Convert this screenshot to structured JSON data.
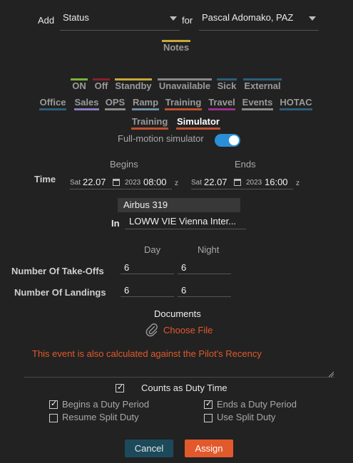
{
  "header": {
    "add_label": "Add",
    "type_value": "Status",
    "for_label": "for",
    "person_value": "Pascal Adomako, PAZ"
  },
  "notes_tab": {
    "label": "Notes",
    "color": "#c8a83a"
  },
  "status_row": [
    {
      "label": "ON",
      "color": "#7bb23a"
    },
    {
      "label": "Off",
      "color": "#8a1f2a"
    },
    {
      "label": "Standby",
      "color": "#c8a83a"
    },
    {
      "label": "Unavailable",
      "color": "#8a8a8a"
    },
    {
      "label": "Sick",
      "color": "#2b5f7a"
    },
    {
      "label": "External",
      "color": "#2b5f7a"
    }
  ],
  "category_row": [
    {
      "label": "Office",
      "color": "#2b5f7a"
    },
    {
      "label": "Sales",
      "color": "#8a7bbf"
    },
    {
      "label": "OPS",
      "color": "#8a8a8a"
    },
    {
      "label": "Ramp",
      "color": "#6f8fa6"
    },
    {
      "label": "Training",
      "color": "#c0502e"
    },
    {
      "label": "Travel",
      "color": "#9b2f8a"
    },
    {
      "label": "Events",
      "color": "#8a8a8a"
    },
    {
      "label": "HOTAC",
      "color": "#2b5f7a"
    }
  ],
  "subtype_row": [
    {
      "label": "Training",
      "color": "#c0502e"
    },
    {
      "label": "Simulator",
      "color": "#c0502e"
    }
  ],
  "full_motion": {
    "label": "Full-motion simulator",
    "on": true
  },
  "time": {
    "label": "Time",
    "begins_label": "Begins",
    "ends_label": "Ends",
    "begin": {
      "day": "Sat",
      "date": "22.07",
      "year": "2023",
      "time": "08:00",
      "zone": "z"
    },
    "end": {
      "day": "Sat",
      "date": "22.07",
      "year": "2023",
      "time": "16:00",
      "zone": "z"
    }
  },
  "aircraft": "Airbus 319",
  "location": {
    "in_label": "In",
    "value": "LOWW VIE Vienna Inter..."
  },
  "counts": {
    "day_label": "Day",
    "night_label": "Night",
    "takeoffs_label": "Number Of Take-Offs",
    "takeoffs_day": "6",
    "takeoffs_night": "6",
    "landings_label": "Number Of Landings",
    "landings_day": "6",
    "landings_night": "6"
  },
  "documents": {
    "label": "Documents",
    "choose_file": "Choose File"
  },
  "recency_warning": "This event is also calculated against the Pilot's Recency",
  "duty": {
    "counts_label": "Counts as Duty Time",
    "counts_checked": true,
    "begins_label": "Begins a Duty Period",
    "begins_checked": true,
    "ends_label": "Ends a Duty Period",
    "ends_checked": true,
    "resume_label": "Resume Split Duty",
    "resume_checked": false,
    "use_split_label": "Use Split Duty",
    "use_split_checked": false
  },
  "buttons": {
    "cancel": "Cancel",
    "assign": "Assign"
  },
  "colors": {
    "accent_orange": "#e2592b",
    "accent_blue": "#2a8fd6",
    "cancel_bg": "#1c4a5a",
    "warning_text": "#e2592b"
  }
}
